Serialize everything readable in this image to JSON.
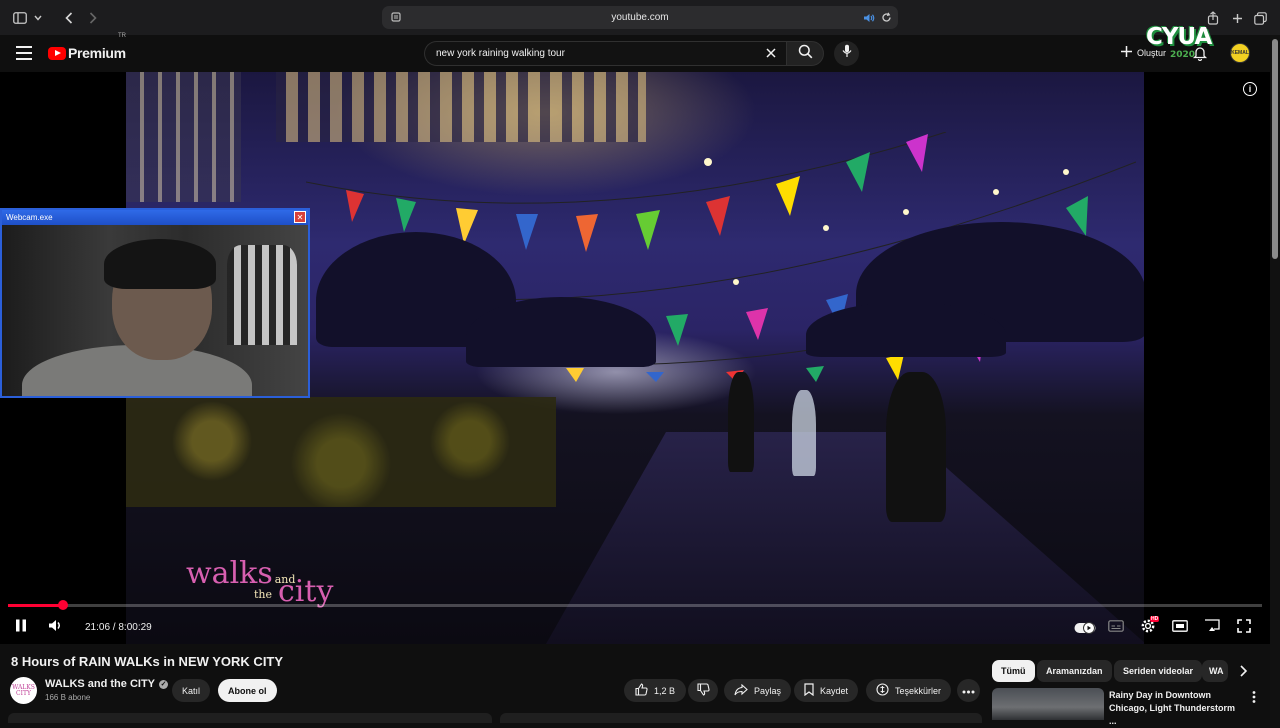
{
  "browser": {
    "url": "youtube.com"
  },
  "header": {
    "logo_text": "Premium",
    "logo_badge": "TR",
    "search_value": "new york raining walking tour",
    "create_label": "Oluştur",
    "overlay_brand": "CYUA",
    "overlay_brand_year": "2020",
    "avatar_text": "KEMAL"
  },
  "player": {
    "current_time": "21:06",
    "duration": "8:00:29",
    "time_display": "21:06 / 8:00:29",
    "progress_fraction": 0.044,
    "accent_color": "#ff0033",
    "watermark_walks": "walks",
    "watermark_and": "and",
    "watermark_the": "the",
    "watermark_city": "city",
    "hd_badge": "HD"
  },
  "webcam": {
    "title": "Webcam.exe",
    "close_label": "✕"
  },
  "video": {
    "title": "8 Hours of RAIN WALKs in NEW YORK CITY",
    "channel_name": "WALKS and the CITY",
    "channel_avatar_text": "WALKS CITY",
    "subscribers": "166 B abone",
    "join_label": "Katıl",
    "subscribe_label": "Abone ol",
    "likes": "1,2 B",
    "share_label": "Paylaş",
    "save_label": "Kaydet",
    "thanks_label": "Teşekkürler"
  },
  "sidebar": {
    "chips": [
      "Tümü",
      "Aramanızdan",
      "Seriden videolar",
      "WA"
    ],
    "recommendation_title": "Rainy Day in Downtown Chicago, Light Thunderstorm ..."
  }
}
